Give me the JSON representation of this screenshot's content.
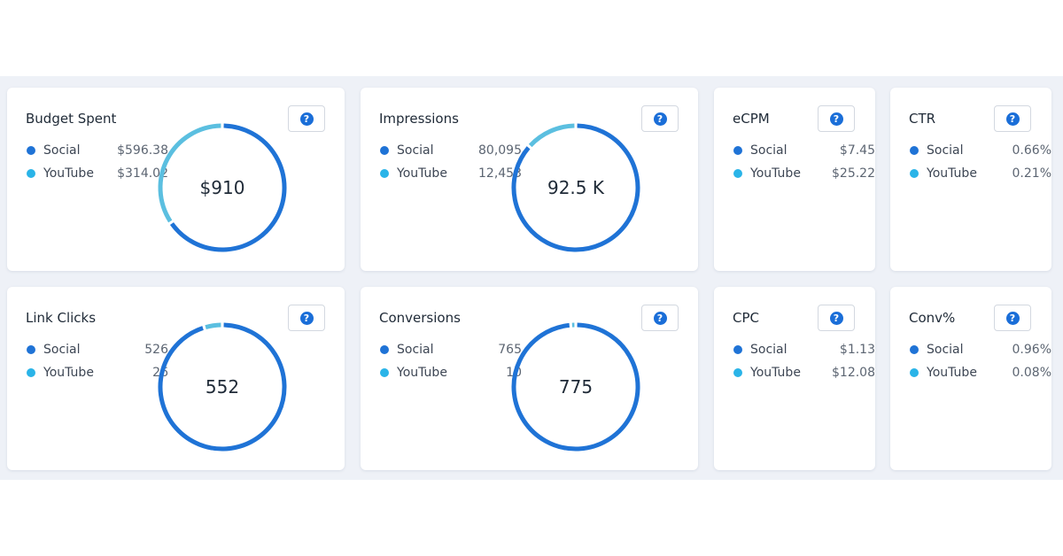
{
  "colors": {
    "social": "#1f73d6",
    "youtube": "#5bbfe0",
    "accent": "#1a6ed8",
    "background": "#eef1f7"
  },
  "help_icon": "question-circle-icon",
  "cards": {
    "budget": {
      "title": "Budget Spent",
      "center": "$910",
      "help": "?",
      "legend": [
        {
          "name": "Social",
          "value": "$596.38"
        },
        {
          "name": "YouTube",
          "value": "$314.02"
        }
      ],
      "chart_data": {
        "type": "pie",
        "categories": [
          "Social",
          "YouTube"
        ],
        "values": [
          596.38,
          314.02
        ]
      }
    },
    "impressions": {
      "title": "Impressions",
      "center": "92.5 K",
      "help": "?",
      "legend": [
        {
          "name": "Social",
          "value": "80,095"
        },
        {
          "name": "YouTube",
          "value": "12,453"
        }
      ],
      "chart_data": {
        "type": "pie",
        "categories": [
          "Social",
          "YouTube"
        ],
        "values": [
          80095,
          12453
        ]
      }
    },
    "ecpm": {
      "title": "eCPM",
      "help": "?",
      "legend": [
        {
          "name": "Social",
          "value": "$7.45"
        },
        {
          "name": "YouTube",
          "value": "$25.22"
        }
      ]
    },
    "ctr": {
      "title": "CTR",
      "help": "?",
      "legend": [
        {
          "name": "Social",
          "value": "0.66%"
        },
        {
          "name": "YouTube",
          "value": "0.21%"
        }
      ]
    },
    "link_clicks": {
      "title": "Link Clicks",
      "center": "552",
      "help": "?",
      "legend": [
        {
          "name": "Social",
          "value": "526"
        },
        {
          "name": "YouTube",
          "value": "26"
        }
      ],
      "chart_data": {
        "type": "pie",
        "categories": [
          "Social",
          "YouTube"
        ],
        "values": [
          526,
          26
        ]
      }
    },
    "conversions": {
      "title": "Conversions",
      "center": "775",
      "help": "?",
      "legend": [
        {
          "name": "Social",
          "value": "765"
        },
        {
          "name": "YouTube",
          "value": "10"
        }
      ],
      "chart_data": {
        "type": "pie",
        "categories": [
          "Social",
          "YouTube"
        ],
        "values": [
          765,
          10
        ]
      }
    },
    "cpc": {
      "title": "CPC",
      "help": "?",
      "legend": [
        {
          "name": "Social",
          "value": "$1.13"
        },
        {
          "name": "YouTube",
          "value": "$12.08"
        }
      ]
    },
    "conv_rate": {
      "title": "Conv%",
      "help": "?",
      "legend": [
        {
          "name": "Social",
          "value": "0.96%"
        },
        {
          "name": "YouTube",
          "value": "0.08%"
        }
      ]
    }
  }
}
